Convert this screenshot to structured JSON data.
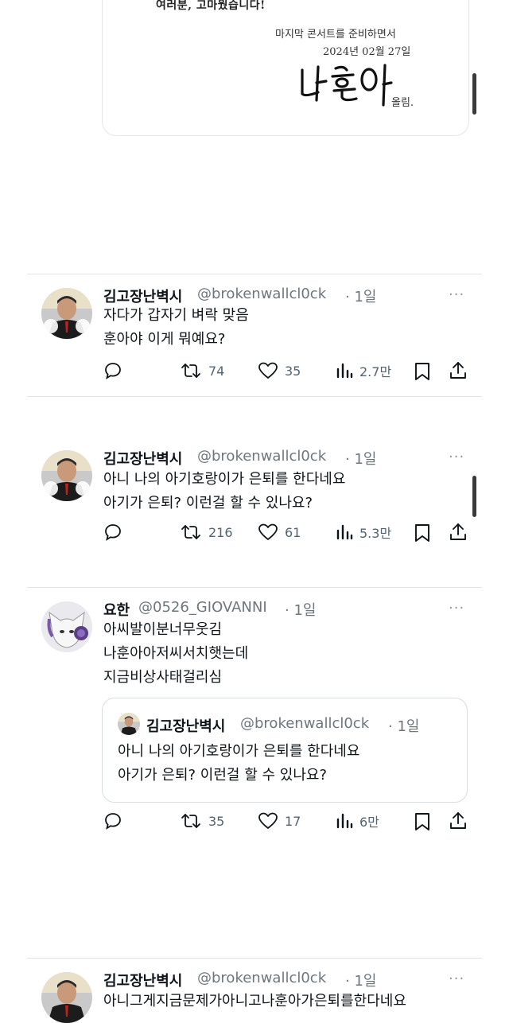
{
  "letter": {
    "line1": "여러분, 고마웠습니다!",
    "line2": "마지막 콘서트를 준비하면서",
    "line3": "2024년 02월 27일",
    "signature": "나훈아",
    "sign_suffix": "올림."
  },
  "tweets": [
    {
      "name": "김고장난벽시",
      "handle": "@brokenwallcl0ck",
      "time": "· 1일",
      "lines": [
        "자다가 갑자기 벼락 맞음",
        "훈아야 이게 뭐예요?"
      ],
      "replies": "",
      "retweets": "74",
      "likes": "35",
      "views": "2.7만"
    },
    {
      "name": "김고장난벽시",
      "handle": "@brokenwallcl0ck",
      "time": "· 1일",
      "lines": [
        "아니 나의 아기호랑이가 은퇴를 한다네요",
        "아기가 은퇴? 이런걸 할 수 있나요?"
      ],
      "replies": "",
      "retweets": "216",
      "likes": "61",
      "views": "5.3만"
    },
    {
      "name": "요한",
      "handle": "@0526_GIOVANNI",
      "time": "· 1일",
      "lines": [
        "아씨발이분너무웃김",
        "나훈아아저씨서치햇는데",
        "지금비상사태걸리심"
      ],
      "quote": {
        "name": "김고장난벽시",
        "handle": "@brokenwallcl0ck",
        "time": "· 1일",
        "lines": [
          "아니 나의 아기호랑이가 은퇴를 한다네요",
          "아기가 은퇴? 이런걸 할 수 있나요?"
        ]
      },
      "replies": "",
      "retweets": "35",
      "likes": "17",
      "views": "6만"
    },
    {
      "name": "김고장난벽시",
      "handle": "@brokenwallcl0ck",
      "time": "· 1일",
      "lines": [
        "아니그게지금문제가아니고나훈아가은퇴를한다네요"
      ]
    }
  ],
  "more_label": "···",
  "colors": {
    "text": "#0f1419",
    "secondary": "#536471",
    "divider": "#e3e3e3"
  }
}
